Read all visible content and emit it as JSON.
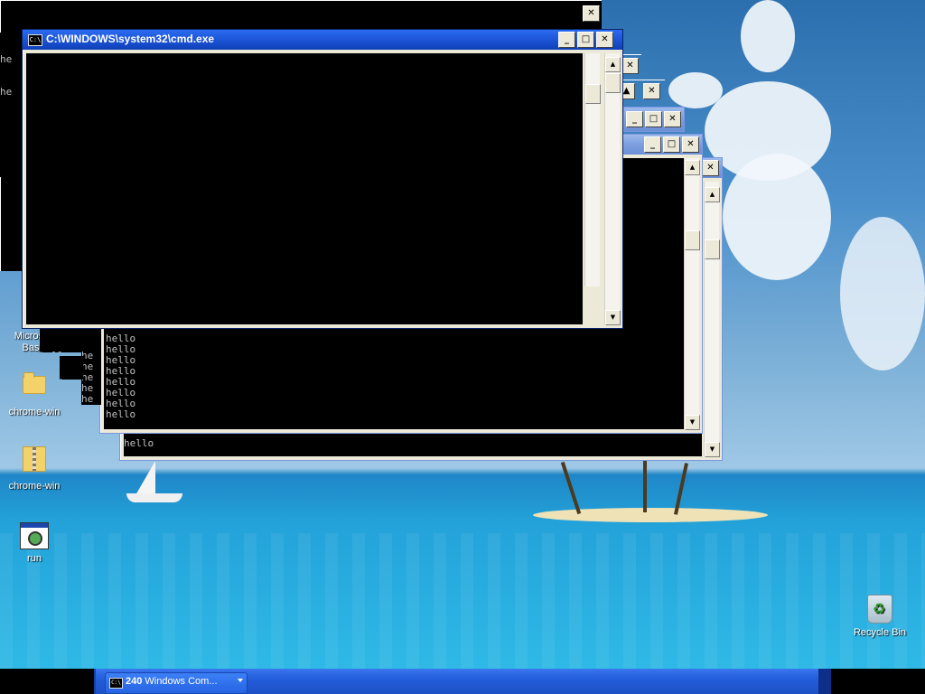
{
  "desktop": {
    "icons": [
      {
        "label": "Microsoft\nBasic",
        "icon": "microsoft-basic-icon"
      },
      {
        "label": "chrome-win",
        "icon": "folder-icon"
      },
      {
        "label": "chrome-win",
        "icon": "zip-folder-icon"
      },
      {
        "label": "run",
        "icon": "run-icon"
      },
      {
        "label": "Recycle Bin",
        "icon": "recycle-bin-icon"
      }
    ]
  },
  "windows": {
    "front": {
      "title": "C:\\WINDOWS\\system32\\cmd.exe",
      "icon_text": "C:\\",
      "min": "_",
      "max": "□",
      "close": "✕"
    },
    "back_left_lines": [
      "he",
      "he",
      "he"
    ],
    "stack_buttons": {
      "min": "_",
      "max": "□",
      "close": "✕"
    },
    "middle_console": {
      "lines": "hello\nhello\nhello\nhello\nhello\nhello\nhello\nhello"
    },
    "lower_console": {
      "lines": "hello"
    },
    "fragments": {
      "a": "hello",
      "b": "he\nhe\nhe\nhe\nhe\nhe",
      "c": "he"
    },
    "scroll": {
      "up": "▲",
      "down": "▼"
    }
  },
  "taskbar": {
    "group_count": "240",
    "group_label": "Windows Com...",
    "icon_text": "C:\\"
  },
  "colors": {
    "titlebar_active": "#1d55d6",
    "titlebar_inactive": "#7d9fe0",
    "console_bg": "#000000",
    "console_text": "#c0c0c0",
    "taskbar": "#245edb"
  }
}
